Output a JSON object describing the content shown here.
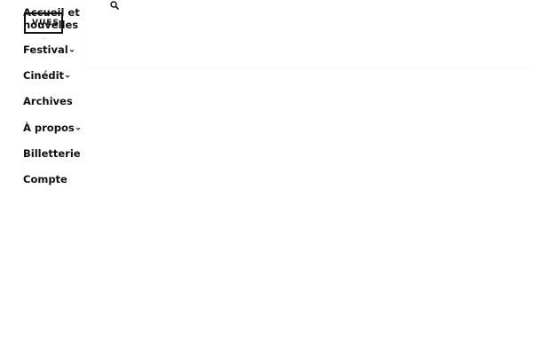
{
  "logo": {
    "text": "VUES",
    "sub": "..."
  },
  "search": {
    "icon": "search-icon"
  },
  "nav": {
    "items": [
      {
        "label": "Accueil et nouvelles",
        "has_dropdown": false
      },
      {
        "label": "Festival",
        "has_dropdown": true
      },
      {
        "label": "Cinédit",
        "has_dropdown": true
      },
      {
        "label": "Archives",
        "has_dropdown": false
      },
      {
        "label": "À propos",
        "has_dropdown": true
      },
      {
        "label": "Billetterie",
        "has_dropdown": false
      },
      {
        "label": "Compte",
        "has_dropdown": false
      }
    ]
  },
  "colors": {
    "text": "#111111",
    "background": "#ffffff"
  }
}
